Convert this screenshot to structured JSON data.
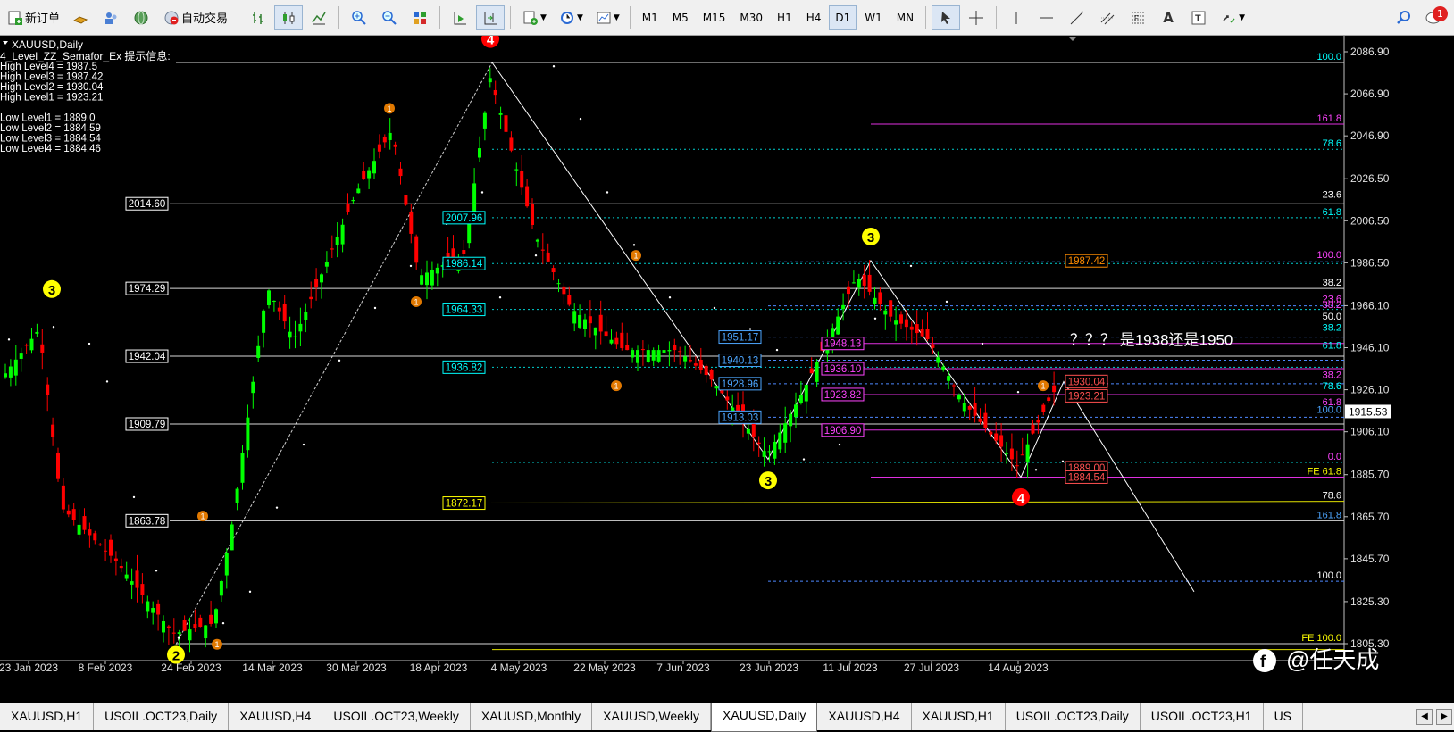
{
  "toolbar": {
    "new_order_label": "新订单",
    "auto_trade_label": "自动交易",
    "timeframes": [
      "M1",
      "M5",
      "M15",
      "M30",
      "H1",
      "H4",
      "D1",
      "W1",
      "MN"
    ],
    "active_timeframe": "D1",
    "notification_count": "1"
  },
  "chart": {
    "symbol_label": "XAUUSD,Daily",
    "indicator_title": "4_Level_ZZ_Semafor_Ex 提示信息:",
    "info_lines": [
      "High Level4 = 1987.5",
      "High Level3 = 1987.42",
      "High Level2 = 1930.04",
      "High Level1 = 1923.21",
      "",
      "Low Level1 = 1889.0",
      "Low Level2 = 1884.59",
      "Low Level3 = 1884.54",
      "Low Level4 = 1884.46"
    ],
    "annotation": "？？？ 是1938还是1950",
    "watermark": "@任天成",
    "current_price": "1915.53",
    "price_axis": [
      "2086.90",
      "2066.90",
      "2046.90",
      "2026.50",
      "2006.50",
      "1986.50",
      "1966.10",
      "1946.10",
      "1926.10",
      "1906.10",
      "1885.70",
      "1865.70",
      "1845.70",
      "1825.30",
      "1805.30"
    ],
    "date_axis": [
      "23 Jan 2023",
      "8 Feb 2023",
      "24 Feb 2023",
      "14 Mar 2023",
      "30 Mar 2023",
      "18 Apr 2023",
      "4 May 2023",
      "22 May 2023",
      "7 Jun 2023",
      "23 Jun 2023",
      "11 Jul 2023",
      "27 Jul 2023",
      "14 Aug 2023"
    ],
    "level_boxes": [
      {
        "label": "2014.60",
        "color": "#ffffff"
      },
      {
        "label": "1974.29",
        "color": "#ffffff"
      },
      {
        "label": "1942.04",
        "color": "#ffffff"
      },
      {
        "label": "1909.79",
        "color": "#ffffff"
      },
      {
        "label": "1863.78",
        "color": "#ffffff"
      },
      {
        "label": "2007.96",
        "color": "#00ffff"
      },
      {
        "label": "1986.14",
        "color": "#00ffff"
      },
      {
        "label": "1964.33",
        "color": "#00ffff"
      },
      {
        "label": "1936.82",
        "color": "#00ffff"
      },
      {
        "label": "1872.17",
        "color": "#ffff00"
      },
      {
        "label": "1951.17",
        "color": "#4da6ff"
      },
      {
        "label": "1940.13",
        "color": "#4da6ff"
      },
      {
        "label": "1928.96",
        "color": "#4da6ff"
      },
      {
        "label": "1913.03",
        "color": "#4da6ff"
      },
      {
        "label": "1948.13",
        "color": "#ff44ff"
      },
      {
        "label": "1936.10",
        "color": "#ff44ff"
      },
      {
        "label": "1923.82",
        "color": "#ff44ff"
      },
      {
        "label": "1906.90",
        "color": "#ff44ff"
      },
      {
        "label": "1987.42",
        "color": "#ff8c00"
      },
      {
        "label": "1930.04",
        "color": "#ff5050"
      },
      {
        "label": "1923.21",
        "color": "#ff5050"
      },
      {
        "label": "1889.00",
        "color": "#ff5050"
      },
      {
        "label": "1884.54",
        "color": "#ff5050"
      }
    ],
    "fib_labels": [
      {
        "label": "100.0",
        "color": "#00ffff"
      },
      {
        "label": "161.8",
        "color": "#ff44ff"
      },
      {
        "label": "78.6",
        "color": "#00ffff"
      },
      {
        "label": "23.6",
        "color": "#ffffff"
      },
      {
        "label": "61.8",
        "color": "#00ffff"
      },
      {
        "label": "100.0",
        "color": "#ff44ff"
      },
      {
        "label": "38.2",
        "color": "#ffffff"
      },
      {
        "label": "23.6",
        "color": "#ff44ff"
      },
      {
        "label": "38.2",
        "color": "#ff44ff"
      },
      {
        "label": "50.0",
        "color": "#ffffff"
      },
      {
        "label": "38.2",
        "color": "#00ffff"
      },
      {
        "label": "61.8",
        "color": "#00ffff"
      },
      {
        "label": "38.2",
        "color": "#ff44ff"
      },
      {
        "label": "78.6",
        "color": "#00ffff"
      },
      {
        "label": "61.8",
        "color": "#ff44ff"
      },
      {
        "label": "100.0",
        "color": "#4da6ff"
      },
      {
        "label": "0.0",
        "color": "#ff44ff"
      },
      {
        "label": "FE 61.8",
        "color": "#ffff00"
      },
      {
        "label": "78.6",
        "color": "#ffffff"
      },
      {
        "label": "161.8",
        "color": "#4da6ff"
      },
      {
        "label": "100.0",
        "color": "#ffffff"
      },
      {
        "label": "FE 100.0",
        "color": "#ffff00"
      }
    ],
    "semafor_big": [
      {
        "label": "4",
        "color": "#ff0000"
      },
      {
        "label": "3",
        "color": "#ffff00"
      },
      {
        "label": "3",
        "color": "#ffff00"
      },
      {
        "label": "3",
        "color": "#ffff00"
      },
      {
        "label": "4",
        "color": "#ff0000"
      },
      {
        "label": "2",
        "color": "#ffff00"
      }
    ],
    "semafor_small_label": "1",
    "bull_color": "#00ff00",
    "bear_color": "#ff0000"
  },
  "tabs": [
    {
      "label": "XAUUSD,H1"
    },
    {
      "label": "USOIL.OCT23,Daily"
    },
    {
      "label": "XAUUSD,H4"
    },
    {
      "label": "USOIL.OCT23,Weekly"
    },
    {
      "label": "XAUUSD,Monthly"
    },
    {
      "label": "XAUUSD,Weekly"
    },
    {
      "label": "XAUUSD,Daily"
    },
    {
      "label": "XAUUSD,H4"
    },
    {
      "label": "XAUUSD,H1"
    },
    {
      "label": "USOIL.OCT23,Daily"
    },
    {
      "label": "USOIL.OCT23,H1"
    },
    {
      "label": "US"
    }
  ],
  "active_tab": "XAUUSD,Daily"
}
